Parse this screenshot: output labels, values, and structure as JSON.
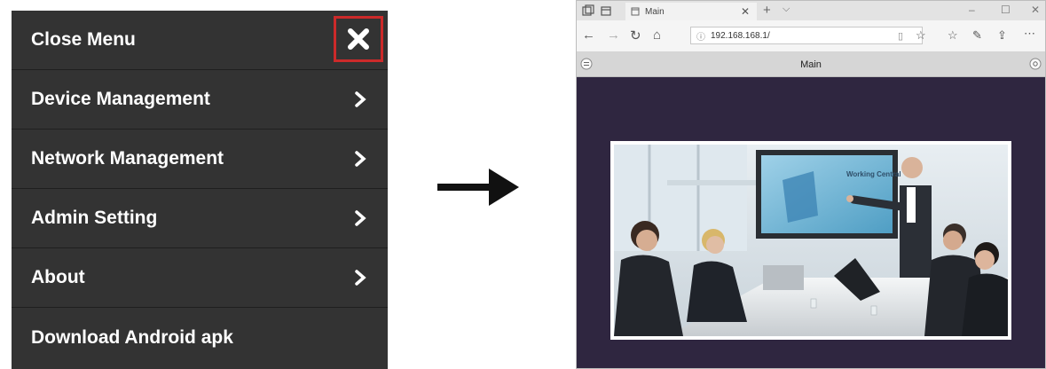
{
  "menu": {
    "items": [
      {
        "label": "Close Menu",
        "icon": "close-icon"
      },
      {
        "label": "Device Management",
        "icon": "chevron-right-icon"
      },
      {
        "label": "Network Management",
        "icon": "chevron-right-icon"
      },
      {
        "label": "Admin Setting",
        "icon": "chevron-right-icon"
      },
      {
        "label": "About",
        "icon": "chevron-right-icon"
      },
      {
        "label": "Download Android apk"
      }
    ],
    "highlight_color": "#cc2a2a",
    "background_color": "#333333"
  },
  "browser": {
    "tab_title": "Main",
    "address": "192.168.168.1/",
    "page_title": "Main",
    "screen_text": "Working Central",
    "background_color": "#2f2640"
  }
}
